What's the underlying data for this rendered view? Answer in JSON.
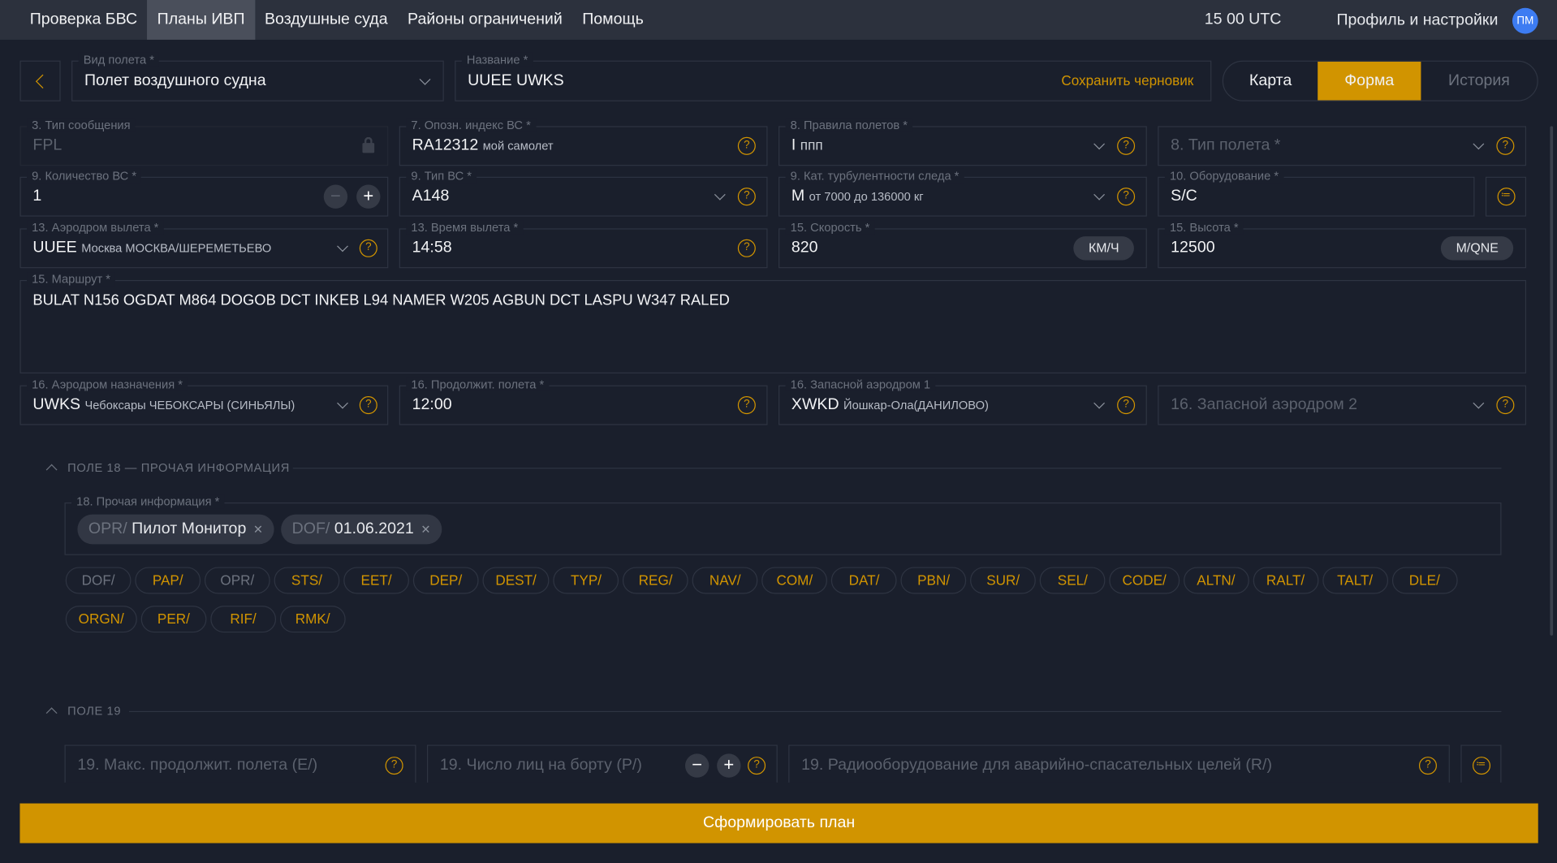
{
  "nav": {
    "items": [
      "Проверка БВС",
      "Планы ИВП",
      "Воздушные суда",
      "Районы ограничений",
      "Помощь"
    ],
    "utc": "15 00 UTC",
    "profile": "Профиль и настройки",
    "avatar": "ПМ"
  },
  "header": {
    "flight_kind_label": "Вид полета *",
    "flight_kind": "Полет воздушного судна",
    "name_label": "Название *",
    "name": "UUEE UWKS",
    "save_draft": "Сохранить черновик",
    "tabs": [
      "Карта",
      "Форма",
      "История"
    ]
  },
  "form": {
    "msg_type": {
      "label": "3. Тип сообщения",
      "value": "FPL"
    },
    "callsign": {
      "label": "7. Опозн. индекс ВС *",
      "value": "RA12312",
      "note": "мой самолет"
    },
    "rules": {
      "label": "8. Правила полетов *",
      "value": "I",
      "note": "ппп"
    },
    "flight_type": {
      "placeholder": "8. Тип полета *"
    },
    "count": {
      "label": "9. Количество ВС *",
      "value": "1"
    },
    "ac_type": {
      "label": "9. Тип ВС *",
      "value": "A148"
    },
    "wake": {
      "label": "9. Кат. турбулентности следа *",
      "value": "M",
      "note": "от 7000 до 136000 кг"
    },
    "equipment": {
      "label": "10. Оборудование *",
      "value": "S/C"
    },
    "dep": {
      "label": "13. Аэродром вылета *",
      "value": "UUEE",
      "note": "Москва МОСКВА/ШЕРЕМЕТЬЕВО"
    },
    "dep_time": {
      "label": "13. Время вылета *",
      "value": "14:58"
    },
    "speed": {
      "label": "15. Скорость *",
      "value": "820",
      "unit": "КМ/Ч"
    },
    "level": {
      "label": "15. Высота *",
      "value": "12500",
      "unit": "M/QNE"
    },
    "route": {
      "label": "15. Маршрут *",
      "value": "BULAT N156 OGDAT M864 DOGOB DCT INKEB L94 NAMER W205 AGBUN DCT LASPU W347 RALED"
    },
    "dest": {
      "label": "16. Аэродром назначения *",
      "value": "UWKS",
      "note": "Чебоксары ЧЕБОКСАРЫ (СИНЬЯЛЫ)"
    },
    "eet": {
      "label": "16. Продолжит. полета *",
      "value": "12:00"
    },
    "altn1": {
      "label": "16. Запасной аэродром 1",
      "value": "XWKD",
      "note": "Йошкар-Ола(ДАНИЛОВО)"
    },
    "altn2": {
      "placeholder": "16. Запасной аэродром 2"
    }
  },
  "field18": {
    "section": "ПОЛЕ 18 — ПРОЧАЯ ИНФОРМАЦИЯ",
    "label": "18. Прочая информация *",
    "tags": [
      {
        "key": "OPR/",
        "value": "Пилот Монитор"
      },
      {
        "key": "DOF/",
        "value": "01.06.2021"
      }
    ],
    "chips_row1": [
      "DOF/",
      "PAP/",
      "OPR/",
      "STS/",
      "EET/",
      "DEP/",
      "DEST/",
      "TYP/",
      "REG/",
      "NAV/",
      "COM/",
      "DAT/",
      "PBN/",
      "SUR/",
      "SEL/",
      "CODE/",
      "ALTN/",
      "RALT/",
      "TALT/",
      "DLE/"
    ],
    "chips_row2": [
      "ORGN/",
      "PER/",
      "RIF/",
      "RMK/"
    ],
    "used": [
      "DOF/",
      "OPR/"
    ]
  },
  "field19": {
    "section": "ПОЛЕ 19",
    "endurance": "19. Макс. продолжит. полета (E/)",
    "persons": "19. Число лиц на борту (P/)",
    "radio": "19. Радиооборудование для аварийно-спасательных целей (R/)"
  },
  "submit": "Сформировать план",
  "colors": {
    "accent": "#d19400",
    "bg": "#1a1f2c",
    "topbar": "#2c313d",
    "avatar": "#3d7cf2"
  }
}
